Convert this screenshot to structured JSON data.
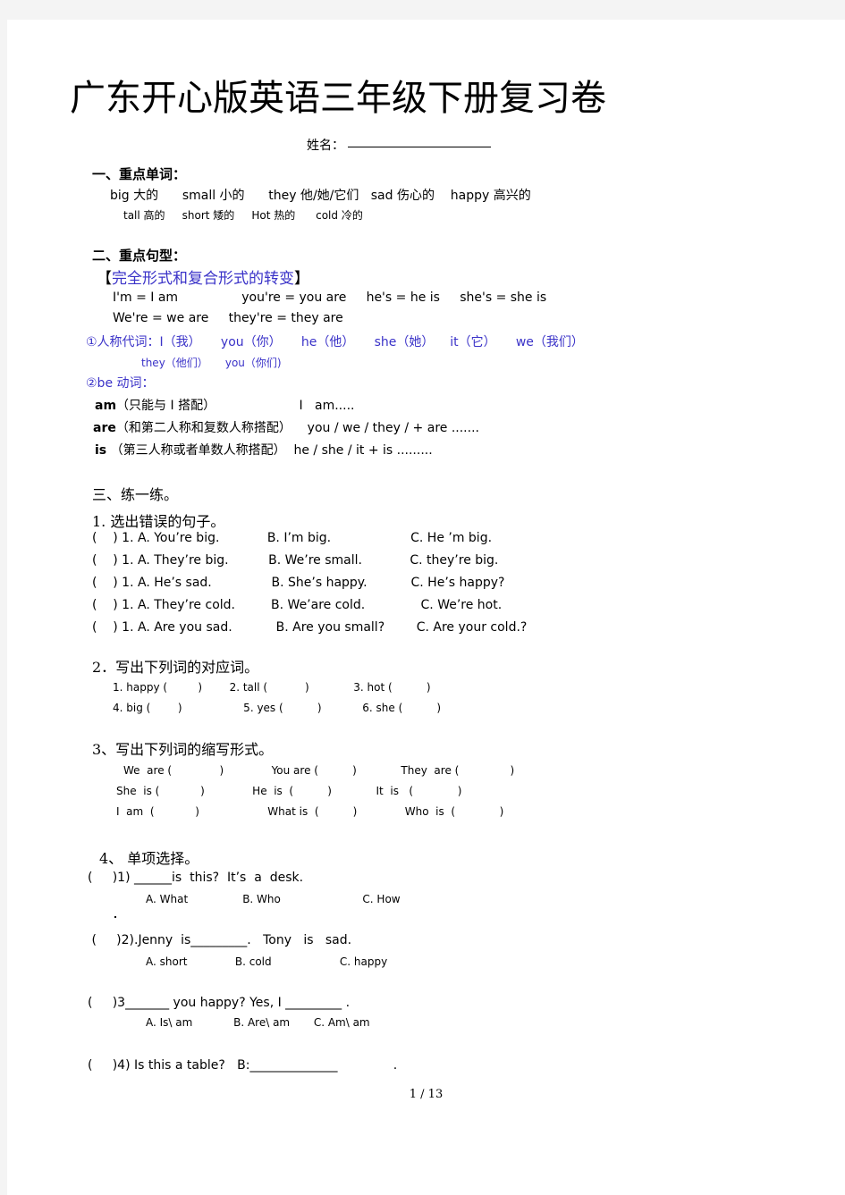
{
  "document": {
    "title": "广东开心版英语三年级下册复习卷",
    "name_field_label": "姓名：",
    "footer": "1 / 13"
  },
  "colors": {
    "text": "#000000",
    "accent_blue": "#3a32c8",
    "page_background": "#ffffff",
    "canvas_background": "#f4f4f4"
  },
  "section1": {
    "heading": "一、重点单词：",
    "row1": "big 大的      small 小的      they 他/她/它们   sad 伤心的    happy 高兴的",
    "row2": "tall 高的     short 矮的     Hot 热的      cold 冷的"
  },
  "section2": {
    "heading": "二、重点句型：",
    "bracket_open": "【",
    "bracket_title": "完全形式和复合形式的转变",
    "bracket_close": "】",
    "contraction_row1": "I'm = I am                you're = you are     he's = he is     she's = she is",
    "contraction_row2": "We're = we are     they're = they are",
    "item1": "①人称代词：I（我）     you（你）     he（他）     she（她）    it（它）     we（我们）",
    "item1b": "they（他们）     you（你们)",
    "item2": "②be 动词：",
    "be_am_bold": "am",
    "be_am_rest": "（只能与 I 搭配）                     I   am.....",
    "be_are_bold": "are",
    "be_are_rest": "（和第二人称和复数人称搭配）    you / we / they / + are .......",
    "be_is_bold": "is",
    "be_is_rest": " （第三人称或者单数人称搭配）  he / she / it + is ........."
  },
  "section3": {
    "heading": "三、练一练。",
    "ex1": {
      "heading": "1.  选出错误的句子。",
      "rows": [
        "(    ) 1. A. You’re big.            B. I’m big.                    C. He ’m big.",
        "(    ) 1. A. They’re big.          B. We’re small.            C. they’re big.",
        "(    ) 1. A. He’s sad.               B. She’s happy.           C. He’s happy?",
        "(    ) 1. A. They’re cold.         B. We’are cold.              C. We’re hot.",
        "(    ) 1. A. Are you sad.           B. Are you small?        C. Are your cold.?"
      ]
    },
    "ex2": {
      "heading": "2．写出下列词的对应词。",
      "row1": "1. happy (         )        2. tall (           )             3. hot (          )",
      "row2": "4. big (        )                  5. yes (          )            6. she (          )"
    },
    "ex3": {
      "heading": "3、写出下列词的缩写形式。",
      "row1": "We  are (              )              You are (          )             They  are (               )",
      "row2": "She  is (            )              He  is  (          )             It  is   (             )",
      "row3": "I  am  (            )                    What is  (          )              Who  is  (             )"
    },
    "ex4": {
      "heading": "4、 单项选择。",
      "q1_stem": "(     )1) ______is  this?  It’s  a  desk.",
      "q1_options": "A. What                B. Who                        C. How",
      "q2_stem": " (     )2).Jenny  is_________.   Tony   is   sad.",
      "q2_options": "A. short              B. cold                    C. happy",
      "q3_stem": "(     )3_______ you happy? Yes, I _________ .",
      "q3_options": "A. Is\\ am            B. Are\\ am       C. Am\\ am",
      "q4_stem": "(     )4) Is this a table?   B:______________              ."
    }
  }
}
